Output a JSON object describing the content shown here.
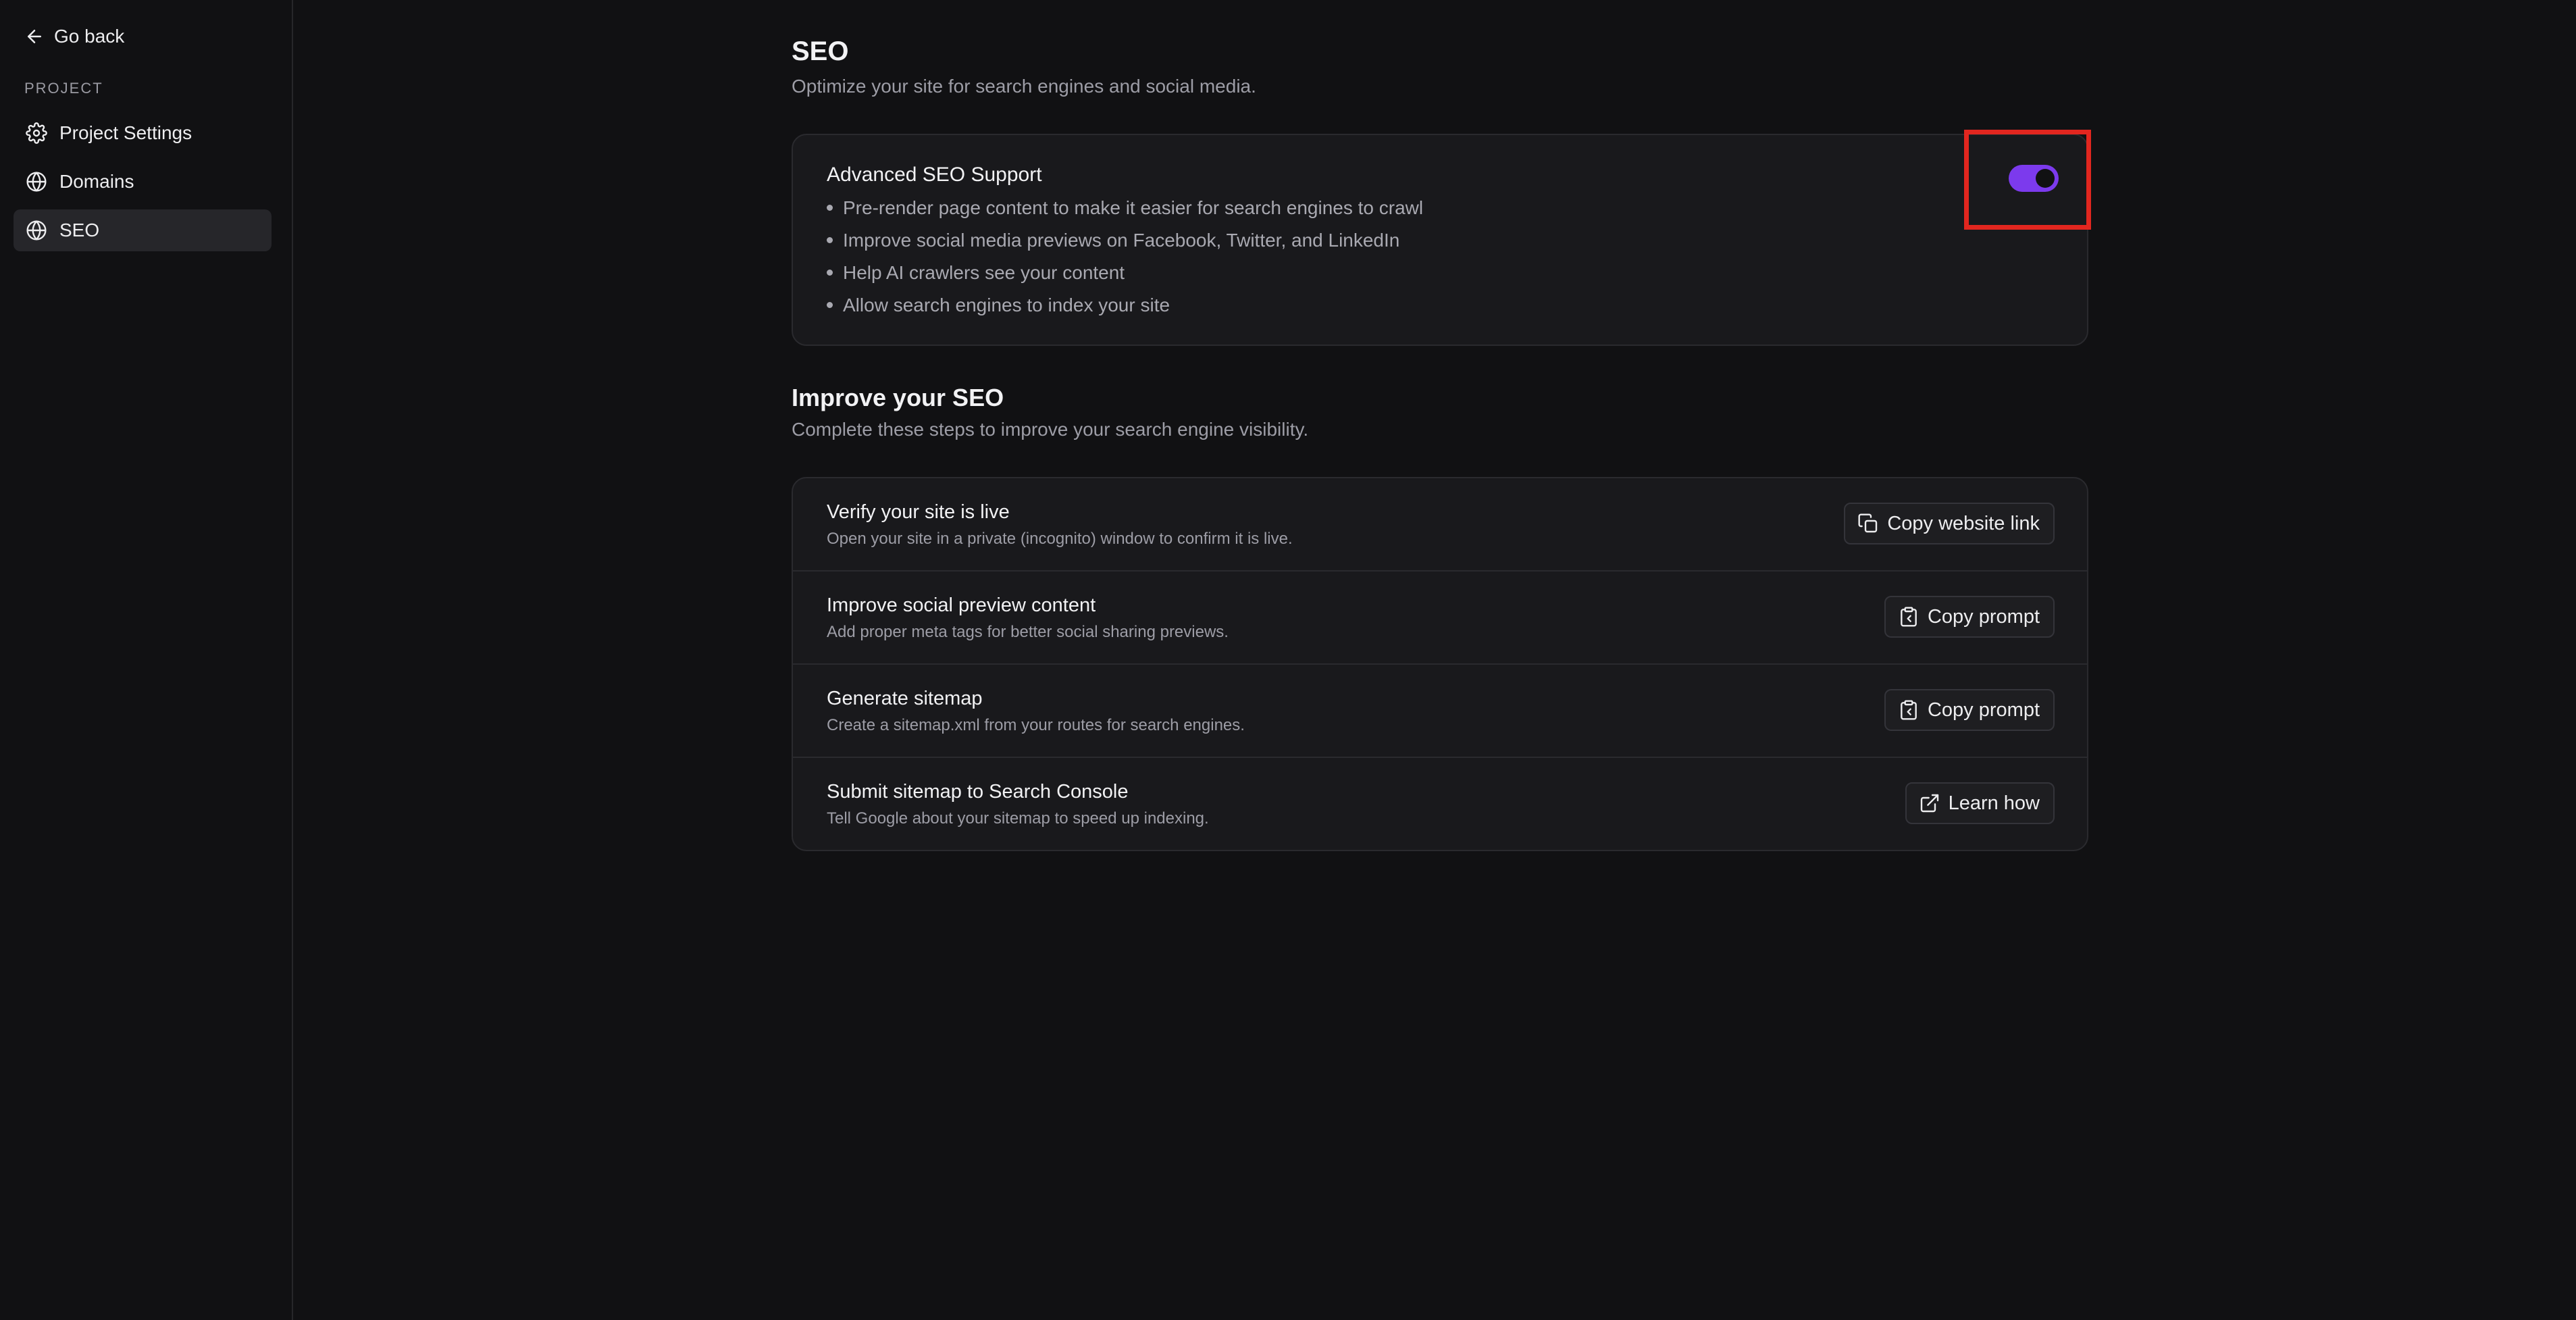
{
  "colors": {
    "background": "#111113",
    "card": "#19191c",
    "accent": "#7c3aed",
    "highlight": "#e2261f"
  },
  "sidebar": {
    "back_label": "Go back",
    "section_label": "PROJECT",
    "items": [
      {
        "label": "Project Settings",
        "icon": "gear-icon"
      },
      {
        "label": "Domains",
        "icon": "globe-icon"
      },
      {
        "label": "SEO",
        "icon": "globe-icon",
        "active": true
      }
    ]
  },
  "page": {
    "title": "SEO",
    "subtitle": "Optimize your site for search engines and social media."
  },
  "advanced": {
    "title": "Advanced SEO Support",
    "enabled": true,
    "bullets": [
      "Pre-render page content to make it easier for search engines to crawl",
      "Improve social media previews on Facebook, Twitter, and LinkedIn",
      "Help AI crawlers see your content",
      "Allow search engines to index your site"
    ]
  },
  "improve": {
    "title": "Improve your SEO",
    "subtitle": "Complete these steps to improve your search engine visibility.",
    "steps": [
      {
        "title": "Verify your site is live",
        "desc": "Open your site in a private (incognito) window to confirm it is live.",
        "button": "Copy website link",
        "icon": "copy-icon"
      },
      {
        "title": "Improve social preview content",
        "desc": "Add proper meta tags for better social sharing previews.",
        "button": "Copy prompt",
        "icon": "clipboard-icon"
      },
      {
        "title": "Generate sitemap",
        "desc": "Create a sitemap.xml from your routes for search engines.",
        "button": "Copy prompt",
        "icon": "clipboard-icon"
      },
      {
        "title": "Submit sitemap to Search Console",
        "desc": "Tell Google about your sitemap to speed up indexing.",
        "button": "Learn how",
        "icon": "external-link-icon"
      }
    ]
  }
}
